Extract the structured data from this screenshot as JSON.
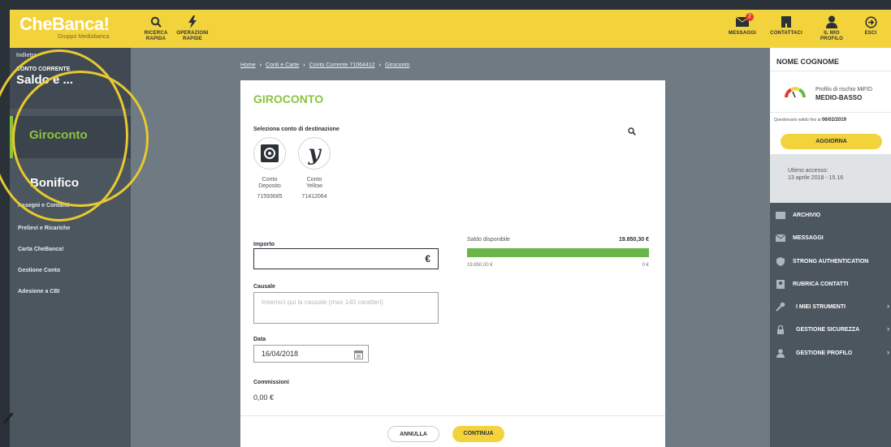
{
  "brand": {
    "name": "CheBanca!",
    "subtitle": "Gruppo Mediobanca"
  },
  "topbar": {
    "search_label_1": "RICERCA",
    "search_label_2": "RAPIDA",
    "ops_label_1": "OPERAZIONI",
    "ops_label_2": "RAPIDE",
    "messages_label": "MESSAGGI",
    "messages_count": "2",
    "contacts_label": "CONTATTACI",
    "profile_label_1": "IL MIO",
    "profile_label_2": "PROFILO",
    "exit_label": "ESCI"
  },
  "sidebar": {
    "back": "Indietro",
    "section": "CONTO CORRENTE",
    "saldo": "Saldo e ...",
    "active": "Giroconto",
    "bonifico": "Bonifico",
    "items": [
      "Assegni e Contanti",
      "Prelievi e Ricariche",
      "Carta CheBanca!",
      "Gestione Conto",
      "Adesione a CBI"
    ]
  },
  "breadcrumb": [
    "Home",
    "Conti e Carte",
    "Conto Corrente 71064412",
    "Giroconto"
  ],
  "form": {
    "title": "GIROCONTO",
    "dest_label": "Seleziona conto di destinazione",
    "accounts": [
      {
        "name_1": "Conto",
        "name_2": "Deposito",
        "number": "71593685"
      },
      {
        "name_1": "Conto",
        "name_2": "Yellow",
        "number": "71412064",
        "glyph": "y"
      }
    ],
    "importo_label": "Importo",
    "currency": "€",
    "saldo_label": "Saldo disponibile",
    "saldo_value": "19.850,30 €",
    "saldo_fill": 1.0,
    "bar_min": "19.850,00 €",
    "bar_max": "0 €",
    "causale_label": "Causale",
    "causale_placeholder": "Inserisci qui la causale (max 140 caratteri)",
    "data_label": "Data",
    "data_value": "16/04/2018",
    "commissioni_label": "Commissioni",
    "commissioni_value": "0,00 €",
    "cancel": "ANNULLA",
    "continue": "CONTINUA"
  },
  "rpanel": {
    "name": "NOME COGNOME",
    "risk_label": "Profilo di rischio MiFID",
    "risk_value": "MEDIO-BASSO",
    "quest_prefix": "Questionario valido fino al",
    "quest_date": "06/02/2019",
    "update": "AGGIORNA",
    "access_label": "Ultimo accesso:",
    "access_value": "13 aprile 2018 - 15.16",
    "menu": [
      "ARCHIVIO",
      "MESSAGGI",
      "STRONG AUTHENTICATION",
      "RUBRICA CONTATTI",
      "I MIEI STRUMENTI",
      "GESTIONE SICUREZZA",
      "GESTIONE PROFILO"
    ]
  },
  "colors": {
    "accent_yellow": "#f3d33c",
    "accent_green": "#8ac53e",
    "sidebar": "#4c565f"
  }
}
